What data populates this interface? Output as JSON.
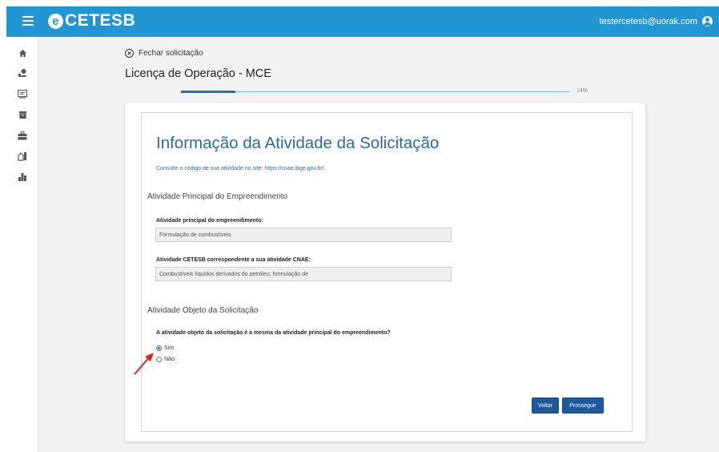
{
  "header": {
    "logo": "CETESB",
    "logo_mark": "e",
    "user_email": "testercetesb@uorak.com"
  },
  "sidebar": {
    "icons": [
      "home-icon",
      "tree-location-icon",
      "screen-list-icon",
      "archive-icon",
      "briefcase-icon",
      "building-icon",
      "city-icon"
    ]
  },
  "page": {
    "close_label": "Fechar solicitação",
    "title": "Licença de Operação - MCE",
    "progress_percent": 14,
    "progress_label": "14%"
  },
  "form": {
    "heading": "Informação da Atividade da Solicitação",
    "help_text": "Consulte o código de sua atividade no site: https://cnae.ibge.gov.br/",
    "section1_title": "Atividade Principal do Empreendimento",
    "field1_label": "Atividade principal do empreendimento:",
    "field1_value": "Formulação de combustíveis",
    "field2_label": "Atividade CETESB correspondente a sua atividade CNAE:",
    "field2_value": "Combustíveis líquidos derivados do petróleo; formulação de",
    "section2_title": "Atividade Objeto da Solicitação",
    "question": "A atividade objeto da solicitação é a mesma da atividade principal do empreendimento?",
    "option_yes": "Sim",
    "option_no": "Não",
    "selected": "Sim",
    "back_label": "Voltar",
    "next_label": "Prosseguir"
  },
  "colors": {
    "topbar": "#2196d3",
    "accent": "#1e5a99",
    "heading": "#2a6aa8",
    "annotation_arrow": "#e02020"
  }
}
